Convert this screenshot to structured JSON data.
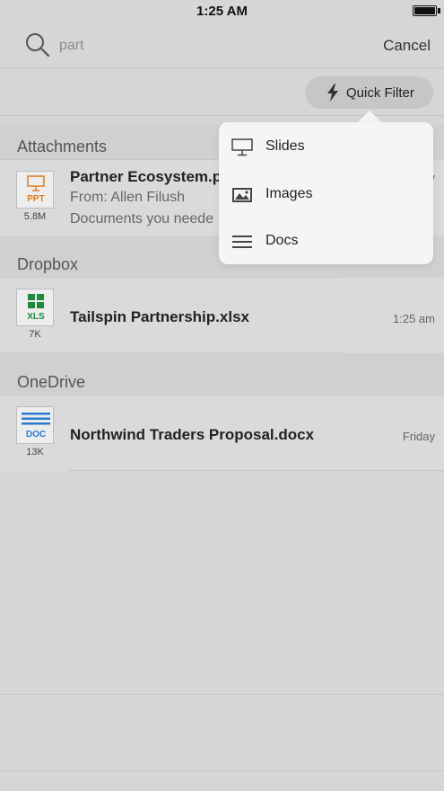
{
  "status": {
    "time": "1:25 AM"
  },
  "search": {
    "value": "part",
    "cancel_label": "Cancel"
  },
  "quick_filter": {
    "label": "Quick Filter"
  },
  "sections": {
    "attachments": {
      "title": "Attachments",
      "file": {
        "type": "PPT",
        "size": "5.8M",
        "name": "Partner Ecosystem.pp",
        "from": "From: Allen Filush",
        "preview": "Documents you neede",
        "time": "y"
      }
    },
    "dropbox": {
      "title": "Dropbox",
      "file": {
        "type": "XLS",
        "size": "7K",
        "name": "Tailspin Partnership.xlsx",
        "time": "1:25 am"
      }
    },
    "onedrive": {
      "title": "OneDrive",
      "file": {
        "type": "DOC",
        "size": "13K",
        "name": "Northwind Traders Proposal.docx",
        "time": "Friday"
      }
    }
  },
  "menu": {
    "items": [
      {
        "label": "Slides",
        "icon": "slides-icon"
      },
      {
        "label": "Images",
        "icon": "images-icon"
      },
      {
        "label": "Docs",
        "icon": "docs-icon"
      }
    ]
  },
  "colors": {
    "ppt": "#e07b20",
    "xls": "#1e8a3e",
    "doc": "#2a7bcf"
  }
}
